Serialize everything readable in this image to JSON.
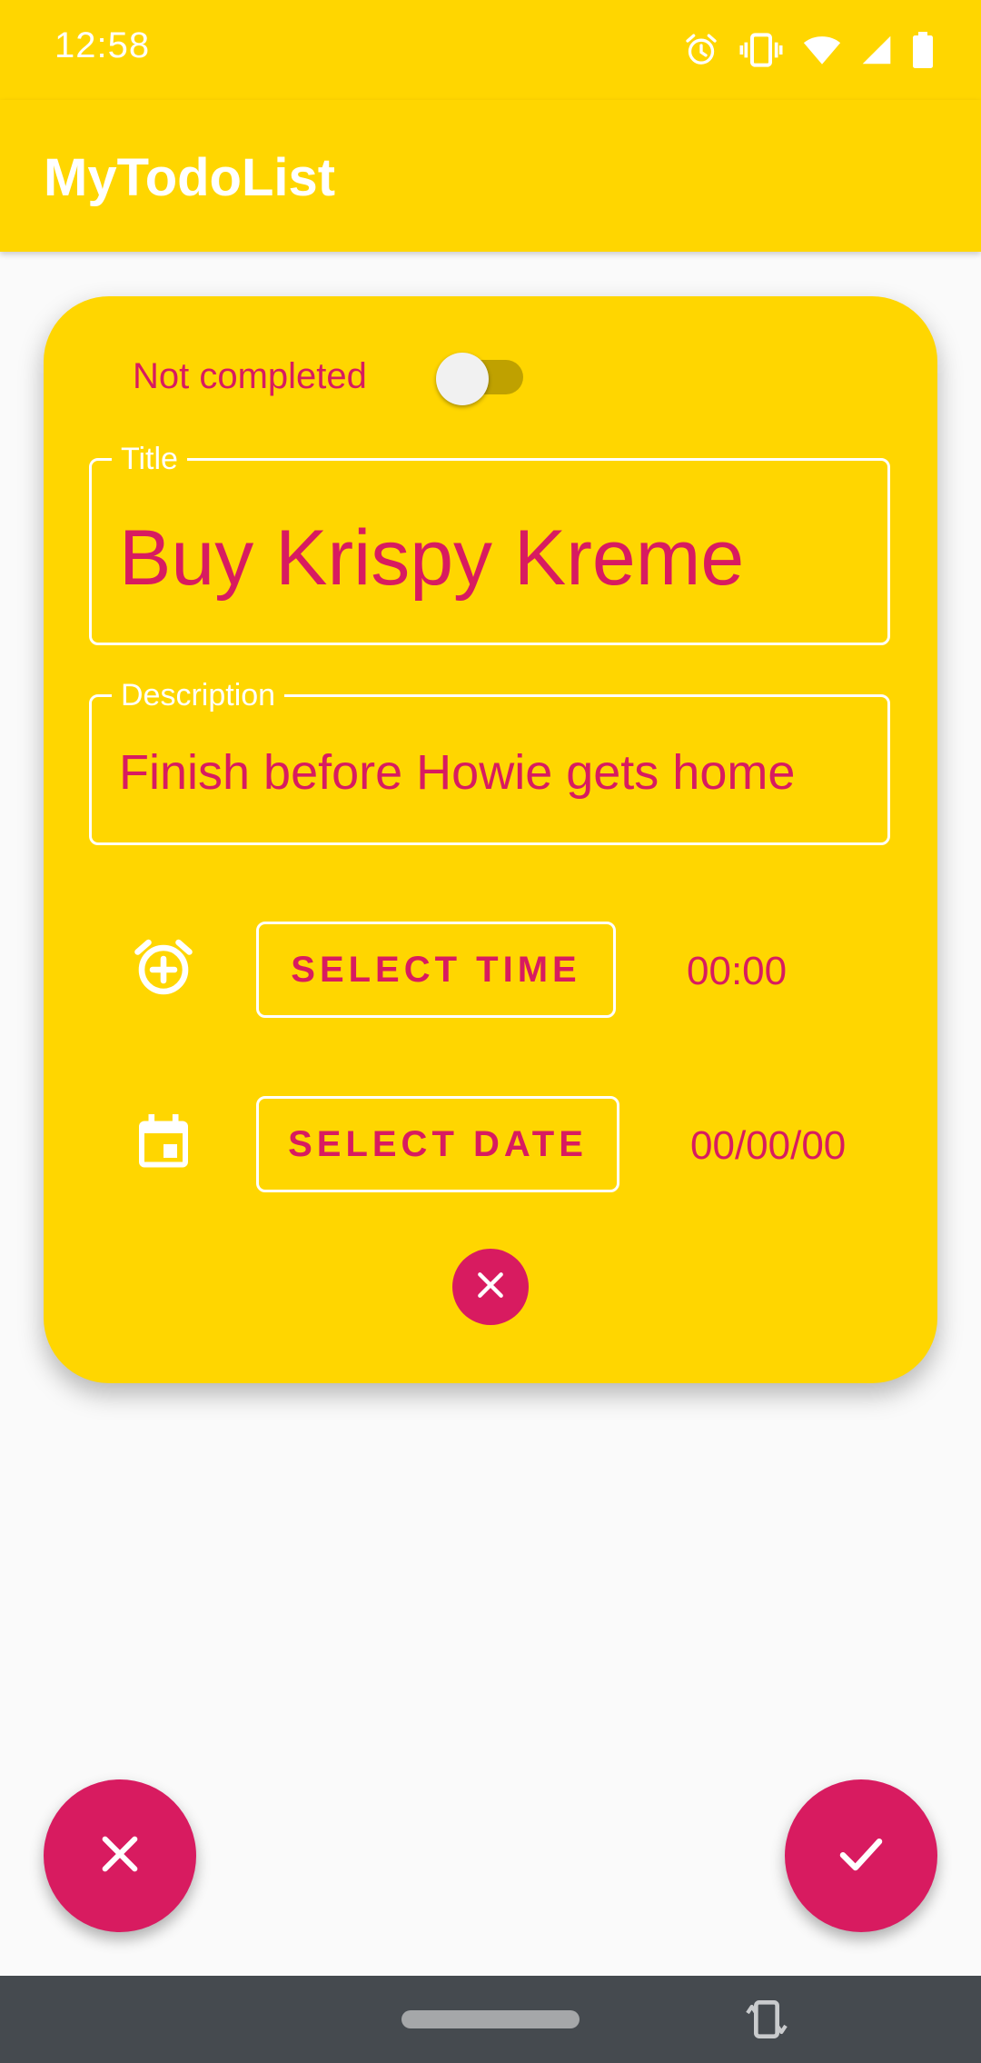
{
  "status_bar": {
    "time": "12:58",
    "icons": [
      "alarm-icon",
      "vibrate-icon",
      "wifi-icon",
      "cell-signal-icon",
      "battery-icon"
    ]
  },
  "app_bar": {
    "title": "MyTodoList"
  },
  "todo_card": {
    "completed_switch": {
      "label": "Not completed",
      "checked": false
    },
    "title_field": {
      "label": "Title",
      "value": "Buy Krispy Kreme"
    },
    "description_field": {
      "label": "Description",
      "value": "Finish before Howie gets home"
    },
    "time_row": {
      "icon": "add-alarm-icon",
      "button_label": "SELECT TIME",
      "value": "00:00"
    },
    "date_row": {
      "icon": "calendar-icon",
      "button_label": "SELECT DATE",
      "value": "00/00/00"
    },
    "clear_button": {
      "icon": "close-icon"
    }
  },
  "fabs": {
    "cancel": {
      "icon": "close-icon"
    },
    "confirm": {
      "icon": "check-icon"
    }
  },
  "nav_bar": {
    "icons": [
      "home-pill",
      "rotate-icon"
    ]
  },
  "colors": {
    "primary": "#ffd600",
    "accent": "#d81b60",
    "background": "#fafafa",
    "nav_bar": "#454a4f",
    "on_primary": "#ffffff"
  }
}
